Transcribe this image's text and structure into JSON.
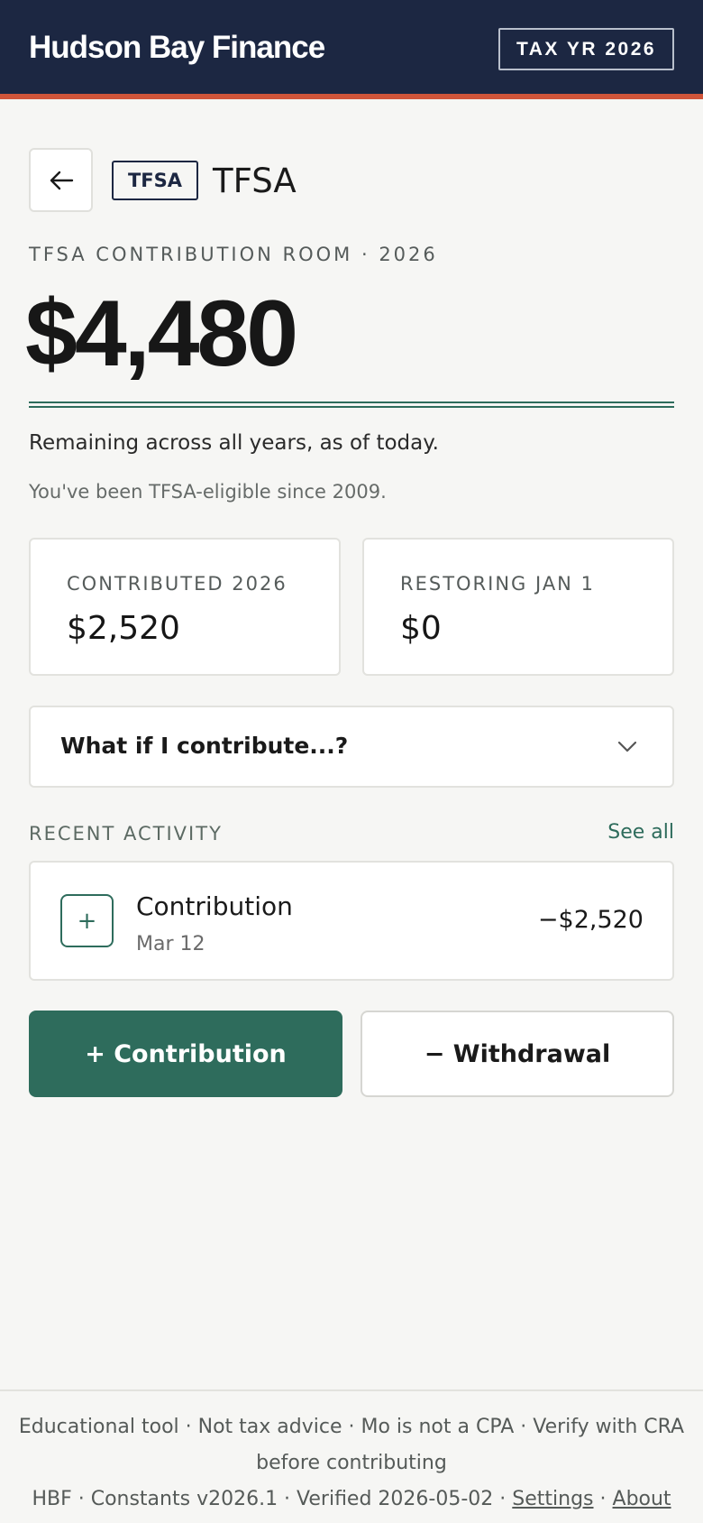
{
  "header": {
    "brand": "Hudson Bay Finance",
    "tax_year_badge": "TAX YR 2026"
  },
  "account": {
    "tag": "TFSA",
    "title": "TFSA"
  },
  "room": {
    "label": "TFSA CONTRIBUTION ROOM · 2026",
    "amount": "$4,480",
    "remaining_text": "Remaining across all years, as of today.",
    "eligible_text": "You've been TFSA-eligible since 2009."
  },
  "stats": [
    {
      "label": "CONTRIBUTED 2026",
      "value": "$2,520"
    },
    {
      "label": "RESTORING JAN 1",
      "value": "$0"
    }
  ],
  "whatif": {
    "question": "What if I contribute...?"
  },
  "activity": {
    "label": "RECENT ACTIVITY",
    "see_all": "See all",
    "items": [
      {
        "icon": "plus-icon",
        "glyph": "+",
        "title": "Contribution",
        "date": "Mar 12",
        "amount": "−$2,520"
      }
    ]
  },
  "actions": {
    "contribution": "+ Contribution",
    "withdrawal": "− Withdrawal"
  },
  "footer": {
    "disclaimer": "Educational tool · Not tax advice · Mo is not a CPA · Verify with CRA before contributing",
    "meta": "HBF · Constants v2026.1 · Verified 2026-05-02 ·",
    "separator": "·",
    "settings": "Settings",
    "about": "About"
  },
  "colors": {
    "header_bg": "#1c2742",
    "accent_stripe": "#d0553a",
    "primary_green": "#2e6c5c",
    "page_bg": "#f6f6f4"
  }
}
